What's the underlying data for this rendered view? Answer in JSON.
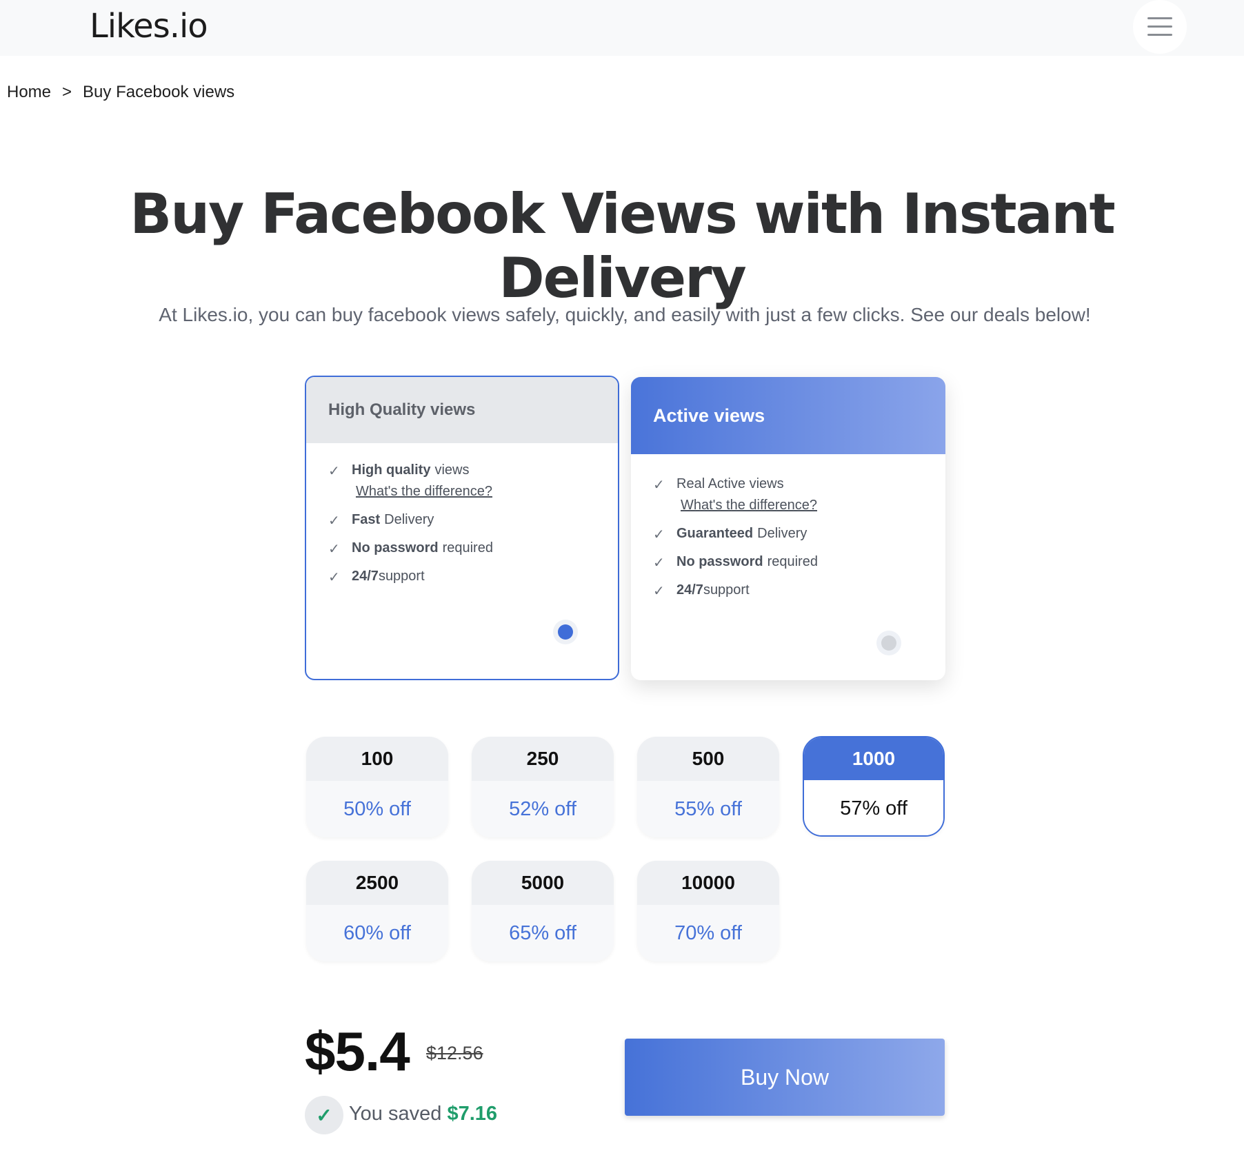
{
  "header": {
    "logo": "Likes.io"
  },
  "breadcrumb": {
    "home": "Home",
    "separator": ">",
    "current": "Buy Facebook views"
  },
  "hero": {
    "title": "Buy Facebook Views with Instant Delivery",
    "subtitle": "At Likes.io, you can buy facebook views safely, quickly, and easily with just a few clicks. See our deals below!"
  },
  "plans": [
    {
      "title": "High Quality views",
      "selected": true,
      "features": [
        {
          "bold": "High quality",
          "text": "views",
          "link": "What's the difference?"
        },
        {
          "bold": "Fast",
          "text": "Delivery"
        },
        {
          "bold": "No password",
          "text": "required"
        },
        {
          "bold": "24/7",
          "text": "support"
        }
      ]
    },
    {
      "title": "Active views",
      "selected": false,
      "features": [
        {
          "bold": "",
          "text": "Real Active views",
          "link": "What's the difference?"
        },
        {
          "bold": "Guaranteed",
          "text": "Delivery"
        },
        {
          "bold": "No password",
          "text": "required"
        },
        {
          "bold": "24/7",
          "text": "support"
        }
      ]
    }
  ],
  "quantities": [
    {
      "amount": "100",
      "discount": "50% off"
    },
    {
      "amount": "250",
      "discount": "52% off"
    },
    {
      "amount": "500",
      "discount": "55% off"
    },
    {
      "amount": "1000",
      "discount": "57% off",
      "selected": true
    },
    {
      "amount": "2500",
      "discount": "60% off"
    },
    {
      "amount": "5000",
      "discount": "65% off"
    },
    {
      "amount": "10000",
      "discount": "70% off"
    }
  ],
  "pricing": {
    "price": "$5.4",
    "old_price": "$12.56",
    "saved_label": "You saved",
    "saved_amount": "$7.16",
    "buy_label": "Buy Now"
  },
  "colors": {
    "accent": "#4672d8",
    "success": "#1f9d6b",
    "text": "#303133"
  },
  "icons": {
    "menu": "hamburger-menu-icon",
    "check": "check-icon",
    "radio": "radio-icon"
  }
}
